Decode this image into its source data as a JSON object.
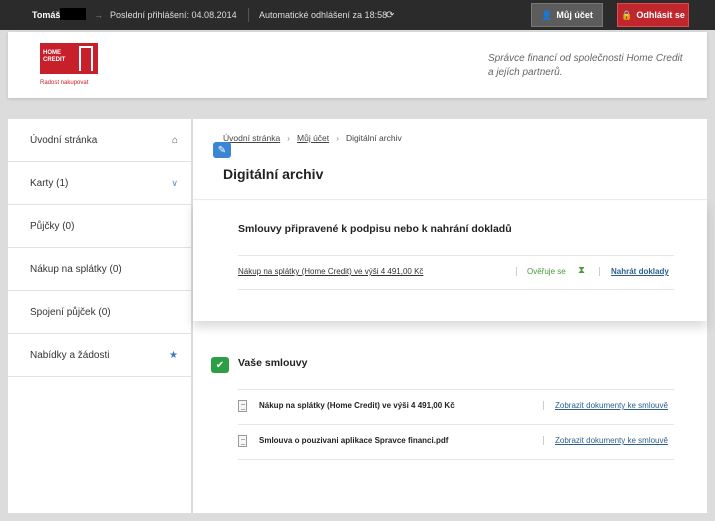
{
  "topbar": {
    "user": "Tomáš",
    "arrow": "→",
    "last_login": "Poslední přihlášení: 04.08.2014",
    "auto_logout": "Automatické odhlášení za 18:58",
    "refresh_icon": "refresh-icon",
    "my_account": "Můj účet",
    "logout": "Odhlásit se"
  },
  "header": {
    "logo_line1": "HOME",
    "logo_line2": "CREDIT",
    "slogan": "Radost nakupovat",
    "tagline_1": "Správce financí od společnosti Home Credit",
    "tagline_2": "a jejích partnerů."
  },
  "sidebar": {
    "items": [
      {
        "label": "Úvodní stránka",
        "icon": "home-icon"
      },
      {
        "label": "Karty (1)",
        "icon": "chevron-down-icon"
      },
      {
        "label": "Půjčky (0)"
      },
      {
        "label": "Nákup na splátky (0)"
      },
      {
        "label": "Spojení půjček (0)"
      },
      {
        "label": "Nabídky a žádosti",
        "icon": "star-icon"
      }
    ]
  },
  "breadcrumb": {
    "home": "Úvodní stránka",
    "account": "Můj účet",
    "current": "Digitální archiv"
  },
  "page_title": "Digitální archiv",
  "pending": {
    "title": "Smlouvy připravené k podpisu nebo k nahrání dokladů",
    "item": "Nákup na splátky (Home Credit) ve výši 4 491,00 Kč",
    "status": "Ověřuje se",
    "action": "Nahrát doklady"
  },
  "contracts": {
    "title": "Vaše smlouvy",
    "items": [
      {
        "name": "Nákup na splátky (Home Credit) ve výši 4 491,00 Kč",
        "action": "Zobrazit dokumenty ke smlouvě"
      },
      {
        "name": "Smlouva o pouzivani aplikace Spravce financi.pdf",
        "action": "Zobrazit dokumenty ke smlouvě"
      }
    ]
  },
  "colors": {
    "brand_red": "#c8202a",
    "accent_blue": "#3a86d4",
    "success_green": "#2c9f45"
  }
}
